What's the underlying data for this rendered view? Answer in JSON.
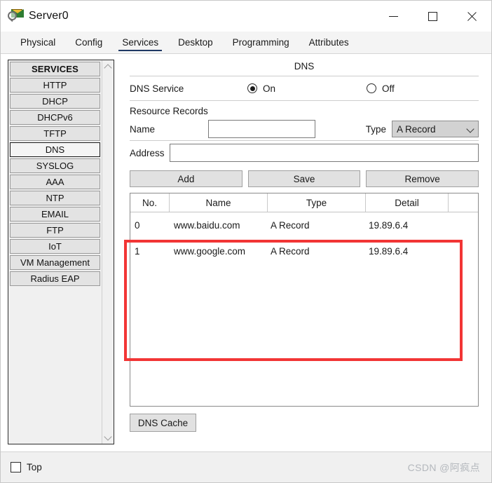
{
  "window": {
    "title": "Server0",
    "icon": "packet-tracer-icon",
    "controls": {
      "minimize": "minimize-icon",
      "maximize": "maximize-icon",
      "close": "close-icon"
    }
  },
  "tabs": [
    {
      "label": "Physical",
      "active": false
    },
    {
      "label": "Config",
      "active": false
    },
    {
      "label": "Services",
      "active": true
    },
    {
      "label": "Desktop",
      "active": false
    },
    {
      "label": "Programming",
      "active": false
    },
    {
      "label": "Attributes",
      "active": false
    }
  ],
  "sidebar": {
    "header": "SERVICES",
    "items": [
      {
        "label": "HTTP",
        "selected": false
      },
      {
        "label": "DHCP",
        "selected": false
      },
      {
        "label": "DHCPv6",
        "selected": false
      },
      {
        "label": "TFTP",
        "selected": false
      },
      {
        "label": "DNS",
        "selected": true
      },
      {
        "label": "SYSLOG",
        "selected": false
      },
      {
        "label": "AAA",
        "selected": false
      },
      {
        "label": "NTP",
        "selected": false
      },
      {
        "label": "EMAIL",
        "selected": false
      },
      {
        "label": "FTP",
        "selected": false
      },
      {
        "label": "IoT",
        "selected": false
      },
      {
        "label": "VM Management",
        "selected": false
      },
      {
        "label": "Radius EAP",
        "selected": false
      }
    ],
    "scroll_up": "chevron-up-icon",
    "scroll_down": "chevron-down-icon"
  },
  "panel": {
    "title": "DNS",
    "service_label": "DNS Service",
    "service_on_label": "On",
    "service_off_label": "Off",
    "service_state": "On",
    "resource_records_label": "Resource Records",
    "name_label": "Name",
    "name_value": "",
    "name_placeholder": "",
    "type_label": "Type",
    "type_value": "A Record",
    "type_options": [
      "A Record"
    ],
    "address_label": "Address",
    "address_value": "",
    "address_placeholder": "",
    "buttons": {
      "add": "Add",
      "save": "Save",
      "remove": "Remove"
    },
    "table": {
      "columns": [
        "No.",
        "Name",
        "Type",
        "Detail",
        ""
      ],
      "rows": [
        {
          "no": "0",
          "name": "www.baidu.com",
          "type": "A Record",
          "detail": "19.89.6.4"
        },
        {
          "no": "1",
          "name": "www.google.com",
          "type": "A Record",
          "detail": "19.89.6.4"
        }
      ]
    },
    "dns_cache_button": "DNS Cache"
  },
  "annotation": {
    "color": "#f23535",
    "shape": "rectangle-highlight"
  },
  "footer": {
    "top_checkbox_label": "Top",
    "top_checked": false,
    "watermark": "CSDN @阿疯点"
  }
}
